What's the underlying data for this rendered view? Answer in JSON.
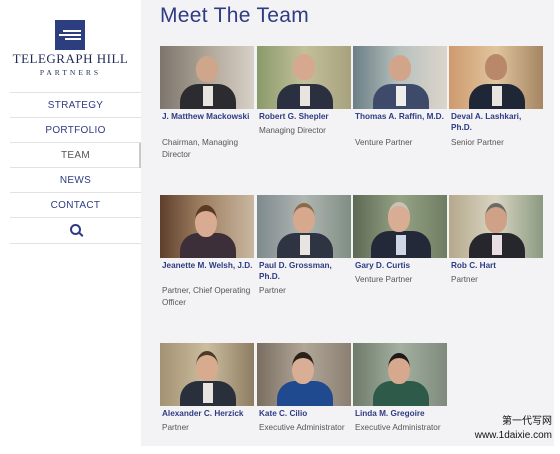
{
  "logo": {
    "name": "TELEGRAPH HILL",
    "sub": "PARTNERS"
  },
  "nav": {
    "items": [
      {
        "label": "STRATEGY"
      },
      {
        "label": "PORTFOLIO"
      },
      {
        "label": "TEAM"
      },
      {
        "label": "NEWS"
      },
      {
        "label": "CONTACT"
      }
    ],
    "search_icon": "search-icon"
  },
  "page": {
    "title": "Meet The Team"
  },
  "team": [
    {
      "name": "J. Matthew Mackowski",
      "role": "Chairman, Managing Director"
    },
    {
      "name": "Robert G. Shepler",
      "role": "Managing Director"
    },
    {
      "name": "Thomas A. Raffin, M.D.",
      "role": "Venture Partner"
    },
    {
      "name": "Deval A. Lashkari, Ph.D.",
      "role": "Senior Partner"
    },
    {
      "name": "Jeanette M. Welsh, J.D.",
      "role": "Partner, Chief Operating Officer"
    },
    {
      "name": "Paul D. Grossman, Ph.D.",
      "role": "Partner"
    },
    {
      "name": "Gary D. Curtis",
      "role": "Venture Partner"
    },
    {
      "name": "Rob C. Hart",
      "role": "Partner"
    },
    {
      "name": "Alexander C. Herzick",
      "role": "Partner"
    },
    {
      "name": "Kate C. Cilio",
      "role": "Executive Administrator"
    },
    {
      "name": "Linda M. Gregoire",
      "role": "Executive Administrator"
    }
  ],
  "watermark": {
    "line1": "第一代写网",
    "line2": "www.1daixie.com"
  },
  "colors": {
    "brand": "#2f3b82",
    "background": "#f3f3f5"
  }
}
